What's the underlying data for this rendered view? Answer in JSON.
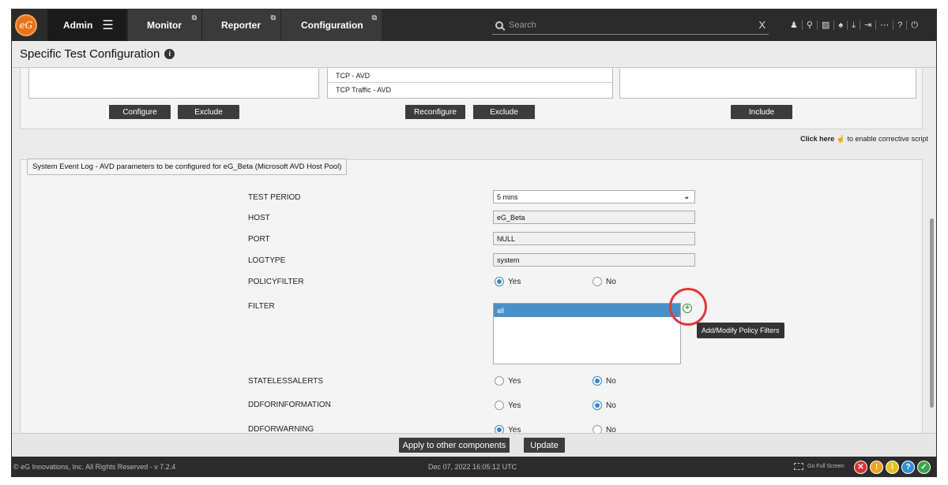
{
  "topbar": {
    "logo_text": "eG",
    "admin_label": "Admin",
    "tabs": [
      {
        "label": "Monitor"
      },
      {
        "label": "Reporter"
      },
      {
        "label": "Configuration"
      }
    ],
    "search_placeholder": "Search",
    "search_clear": "X",
    "toolbar_icons": [
      "user-icon",
      "link-icon",
      "layout-icon",
      "bell-icon",
      "download-icon",
      "logout-icon",
      "more-icon",
      "help-icon",
      "power-icon"
    ],
    "toolbar_glyphs": [
      "♟",
      "⚲",
      "▨",
      "♠",
      "⤓",
      "⇥",
      "⋯",
      "?",
      "⏻"
    ]
  },
  "page": {
    "title": "Specific Test Configuration",
    "info_glyph": "i"
  },
  "top_panel": {
    "middle_list": [
      "TCP - AVD",
      "TCP Traffic - AVD"
    ],
    "left_buttons": [
      "Configure",
      "Exclude"
    ],
    "middle_buttons": [
      "Reconfigure",
      "Exclude"
    ],
    "right_buttons": [
      "Include"
    ],
    "click_here_bold": "Click here",
    "click_here_rest": "to enable corrective script"
  },
  "main_panel": {
    "legend": "System Event Log - AVD parameters to be configured for eG_Beta (Microsoft AVD Host Pool)",
    "params": {
      "test_period": {
        "label": "TEST PERIOD",
        "value": "5 mins"
      },
      "host": {
        "label": "HOST",
        "value": "eG_Beta"
      },
      "port": {
        "label": "PORT",
        "value": "NULL"
      },
      "logtype": {
        "label": "LOGTYPE",
        "value": "system"
      },
      "policyfilter": {
        "label": "POLICYFILTER",
        "yes": "Yes",
        "no": "No",
        "selected": "Yes"
      },
      "filter": {
        "label": "FILTER",
        "selected_value": "all",
        "tooltip": "Add/Modify Policy Filters"
      },
      "statelessalerts": {
        "label": "STATELESSALERTS",
        "yes": "Yes",
        "no": "No",
        "selected": "No"
      },
      "ddforinformation": {
        "label": "DDFORINFORMATION",
        "yes": "Yes",
        "no": "No",
        "selected": "No"
      },
      "ddforwarning": {
        "label": "DDFORWARNING",
        "yes": "Yes",
        "no": "No",
        "selected": "Yes"
      }
    }
  },
  "actions": {
    "apply_label": "Apply to other components",
    "update_label": "Update"
  },
  "footer": {
    "copyright": "© eG Innovations, Inc. All Rights Reserved - v 7.2.4",
    "timestamp": "Dec 07, 2022 16:05:12 UTC",
    "fullscreen_label": "Go Full Screen",
    "status": [
      {
        "glyph": "✕",
        "color": "#d9302c"
      },
      {
        "glyph": "!",
        "color": "#f0a020"
      },
      {
        "glyph": "i",
        "color": "#e6c21a"
      },
      {
        "glyph": "?",
        "color": "#2f8fd6"
      },
      {
        "glyph": "✓",
        "color": "#3aa64a"
      }
    ]
  }
}
